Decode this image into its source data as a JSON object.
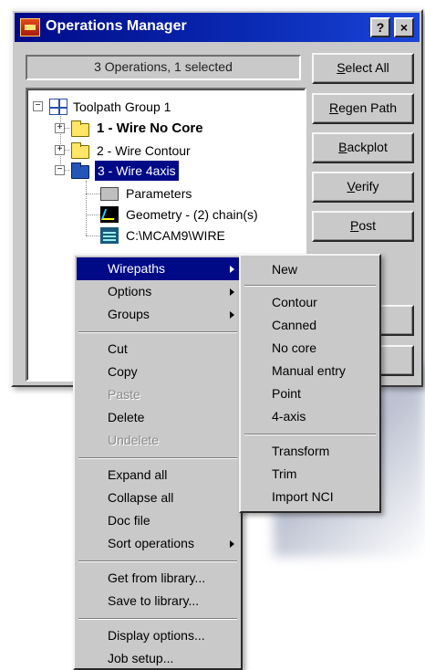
{
  "window": {
    "title": "Operations Manager",
    "help_label": "?",
    "close_label": "×",
    "status": "3 Operations, 1 selected"
  },
  "buttons": {
    "select_all": "Select All",
    "regen_path": "Regen Path",
    "backplot": "Backplot",
    "verify": "Verify",
    "post": "Post"
  },
  "tree": {
    "group": "Toolpath Group 1",
    "op1": "1 - Wire No Core",
    "op2": "2 - Wire Contour",
    "op3": "3 - Wire 4axis",
    "parameters": "Parameters",
    "geometry": "Geometry - (2) chain(s)",
    "nc_file": "C:\\MCAM9\\WIRE",
    "minus_label": "−",
    "plus_label": "+"
  },
  "context_menu": {
    "wirepaths": "Wirepaths",
    "options": "Options",
    "groups": "Groups",
    "cut": "Cut",
    "copy": "Copy",
    "paste": "Paste",
    "delete": "Delete",
    "undelete": "Undelete",
    "expand_all": "Expand all",
    "collapse_all": "Collapse all",
    "doc_file": "Doc file",
    "sort_operations": "Sort operations",
    "get_from_library": "Get from library...",
    "save_to_library": "Save to library...",
    "display_options": "Display options...",
    "job_setup": "Job setup..."
  },
  "submenu": {
    "new": "New",
    "contour": "Contour",
    "canned": "Canned",
    "no_core": "No core",
    "manual_entry": "Manual entry",
    "point": "Point",
    "four_axis": "4-axis",
    "transform": "Transform",
    "trim": "Trim",
    "import_nci": "Import NCI"
  },
  "colors": {
    "selection": "#000a87",
    "title_bar": "#0a2bb5",
    "face": "#c9c9c9"
  }
}
